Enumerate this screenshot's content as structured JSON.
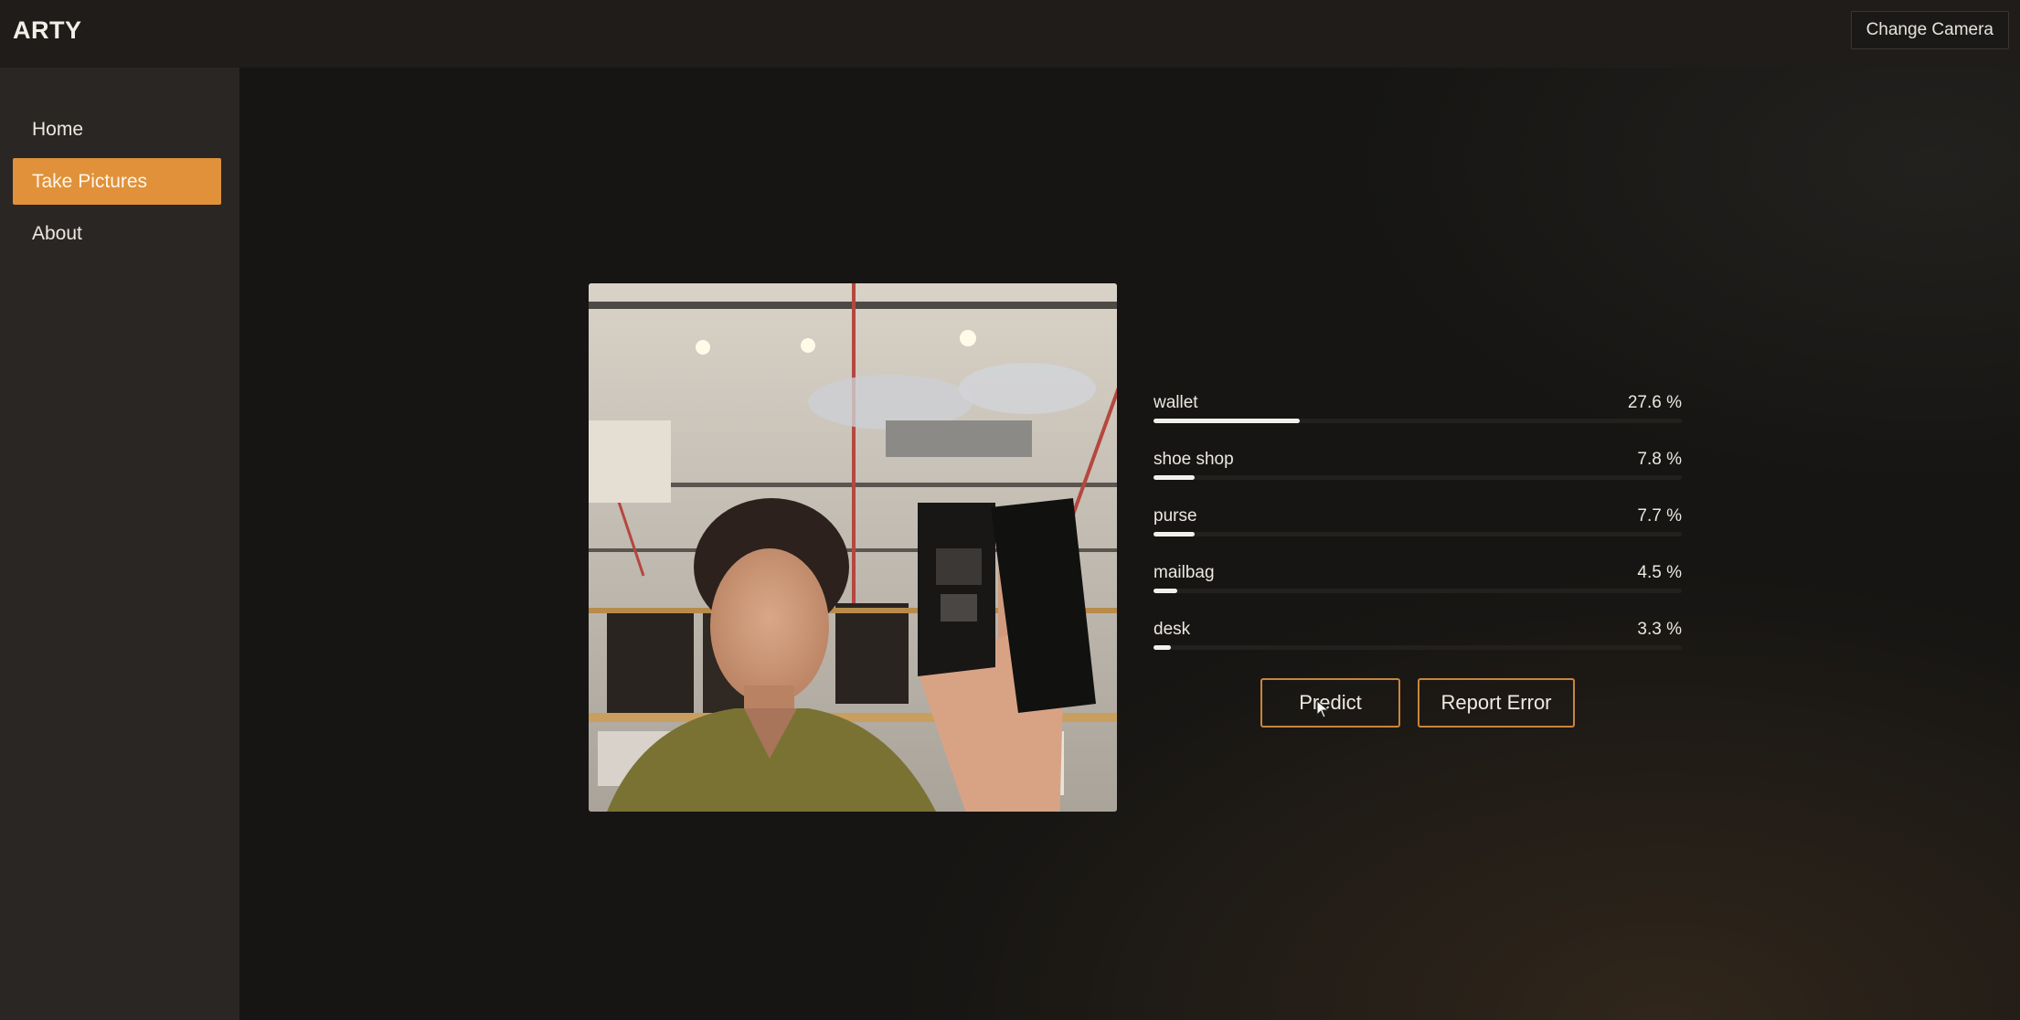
{
  "app": {
    "title": "ARTY",
    "change_camera_label": "Change Camera"
  },
  "sidebar": {
    "items": [
      {
        "label": "Home",
        "active": false
      },
      {
        "label": "Take Pictures",
        "active": true
      },
      {
        "label": "About",
        "active": false
      }
    ]
  },
  "predictions": [
    {
      "label": "wallet",
      "value_text": "27.6 %",
      "value": 27.6
    },
    {
      "label": "shoe shop",
      "value_text": "7.8 %",
      "value": 7.8
    },
    {
      "label": "purse",
      "value_text": "7.7 %",
      "value": 7.7
    },
    {
      "label": "mailbag",
      "value_text": "4.5 %",
      "value": 4.5
    },
    {
      "label": "desk",
      "value_text": "3.3 %",
      "value": 3.3
    }
  ],
  "actions": {
    "predict_label": "Predict",
    "report_error_label": "Report Error"
  },
  "colors": {
    "accent": "#e0913a",
    "background": "#161513",
    "sidebar": "#2a2624",
    "bar_fill": "#f2f0ec"
  }
}
